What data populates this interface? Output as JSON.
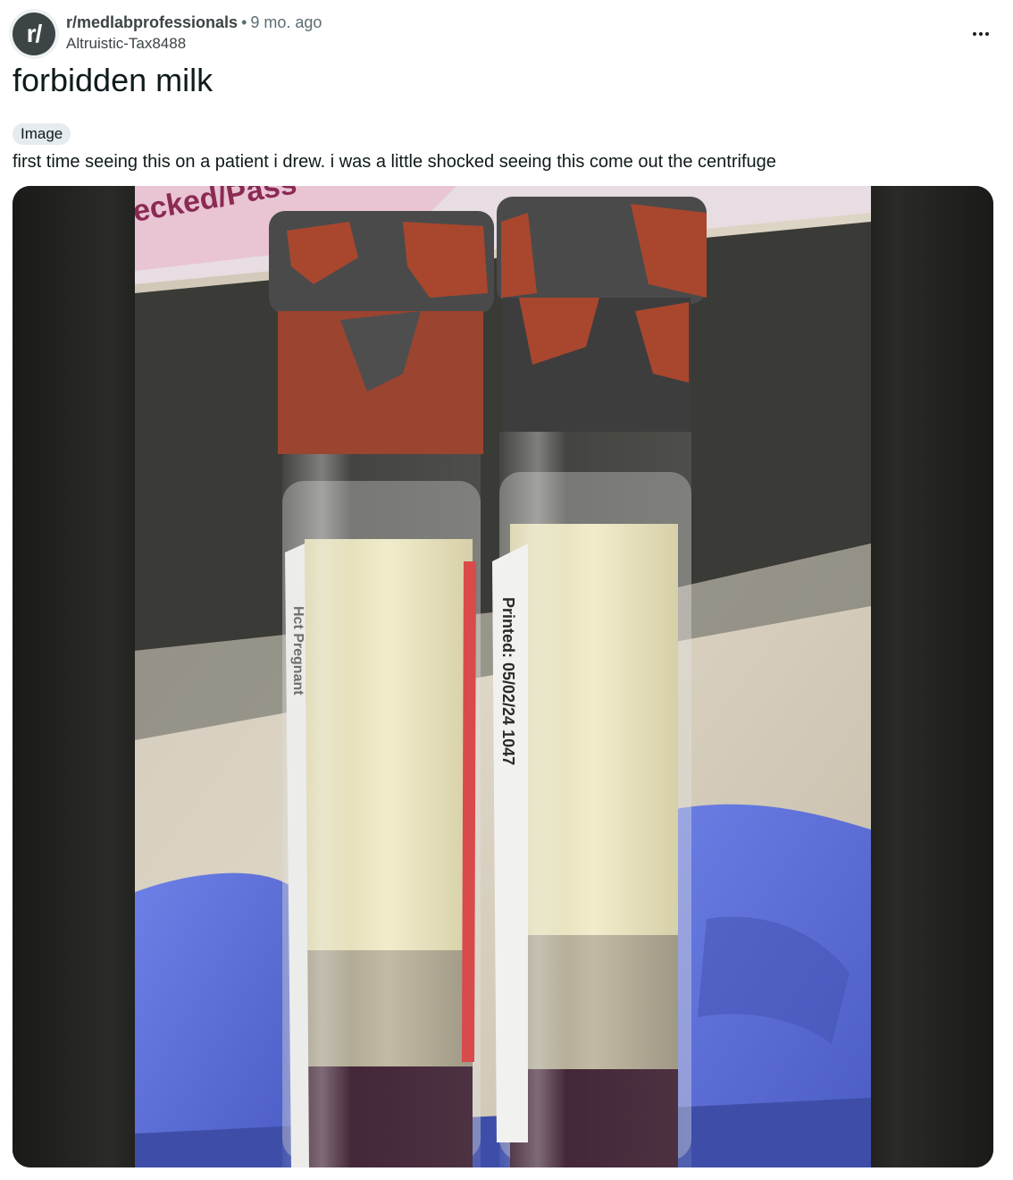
{
  "post": {
    "avatar_glyph": "r/",
    "subreddit": "r/medlabprofessionals",
    "separator": "•",
    "age": "9 mo. ago",
    "author": "Altruistic-Tax8488",
    "title": "forbidden milk",
    "flair": "Image",
    "body": "first time seeing this on a patient i drew. i was a little shocked seeing this come out the centrifuge",
    "image": {
      "sticker_text": "ecked/Pass",
      "label_text": "Printed: 05/02/24 1047",
      "label_text_left": "Hct Pregnant"
    }
  },
  "icons": {
    "more": "more-options-icon"
  },
  "colors": {
    "avatar_bg": "#3c4446",
    "flair_bg": "#e5ebee",
    "glove": "#5b6fd6",
    "serum": "#e6e0b8",
    "cap_red": "#a8472e",
    "cap_gray": "#4a4a4a"
  }
}
